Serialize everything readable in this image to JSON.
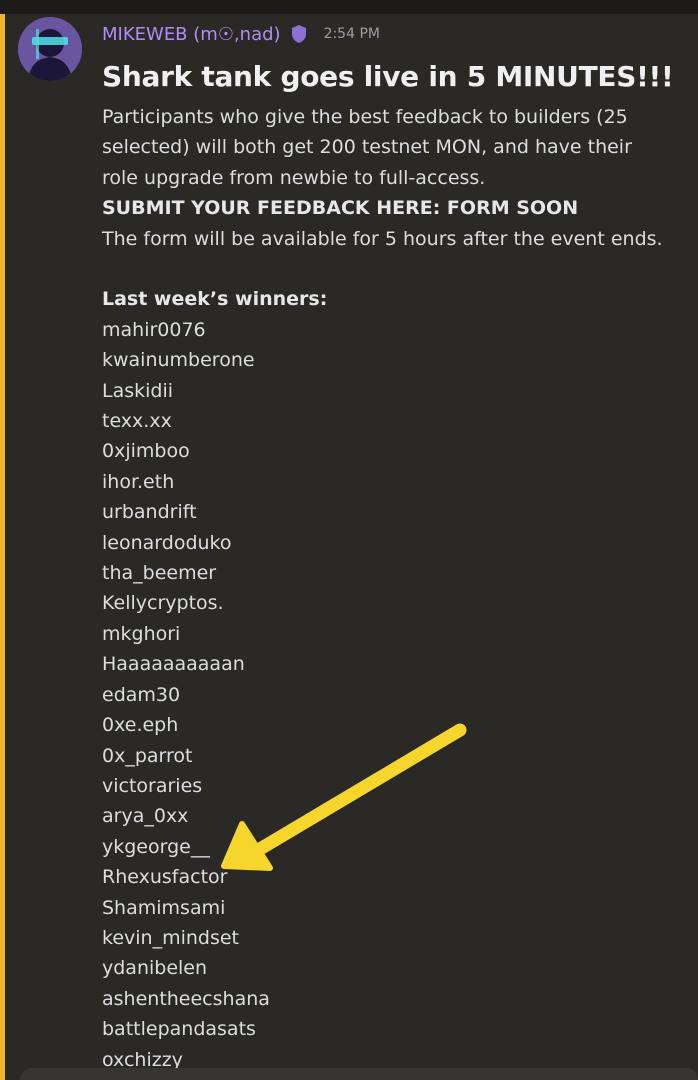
{
  "message": {
    "username": "MIKEWEB (m☉,nad)",
    "timestamp": "2:54 PM",
    "headline": "Shark tank goes live in 5 MINUTES!!!",
    "intro": "Participants who give the best feedback to builders (25 selected) will both get 200 testnet MON, and have their role upgrade from newbie to full-access.",
    "cta": "SUBMIT YOUR FEEDBACK HERE: FORM SOON",
    "availability": "The form will be available for 5 hours after the event ends.",
    "winners_heading": "Last week’s winners:",
    "winners": [
      "mahir0076",
      "kwainumberone",
      "Laskidii",
      "texx.xx",
      "0xjimboo",
      "ihor.eth",
      "urbandrift",
      "leonardoduko",
      "tha_beemer",
      "Kellycryptos.",
      "mkghori",
      "Haaaaaaaaaan",
      "edam30",
      "0xe.eph",
      "0x_parrot",
      "victoraries",
      "arya_0xx",
      "ykgeorge__",
      "Rhexusfactor",
      "Shamimsami",
      "kevin_mindset",
      "ydanibelen",
      "ashentheecshana",
      "battlepandasats",
      "oxchizzy"
    ]
  },
  "colors": {
    "background": "#2b2926",
    "accent_bar": "#f0b232",
    "username": "#b28cf5",
    "arrow": "#f6d52c"
  },
  "icons": {
    "role": "shield-icon",
    "annotation": "arrow-annotation"
  }
}
